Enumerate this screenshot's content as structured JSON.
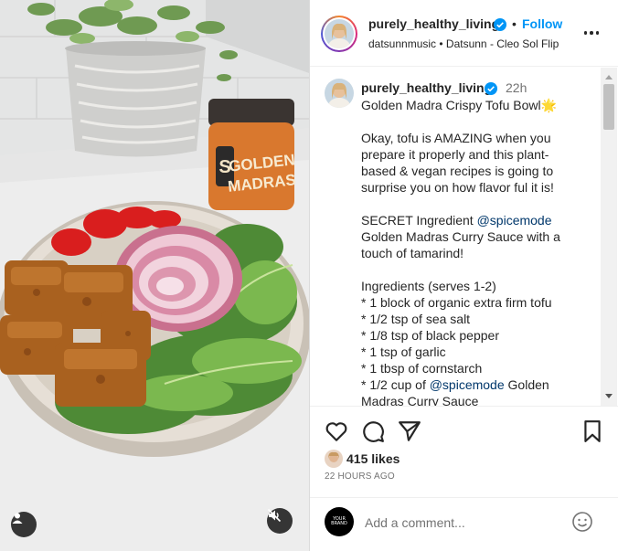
{
  "post": {
    "username": "purely_healthy_living",
    "follow_label": "Follow",
    "separator": "•",
    "audio": "datsunnmusic • Datsunn - Cleo Sol Flip",
    "more_icon": "more-horizontal-icon",
    "verified_icon": "verified-badge-icon"
  },
  "caption": {
    "username": "purely_healthy_living",
    "time": "22h",
    "lines": [
      "Golden Madra Crispy Tofu Bowl🌟",
      "",
      "Okay, tofu is AMAZING when you",
      "prepare it properly and this plant-",
      "based & vegan recipes is going to",
      "surprise you on how flavor ful it is!",
      "",
      "SECRET Ingredient",
      "Golden Madras Curry Sauce with a",
      "touch of tamarind!",
      "",
      "Ingredients (serves 1-2)",
      "* 1 block of organic extra firm tofu",
      "* 1/2 tsp of sea salt",
      "* 1/8 tsp of black pepper",
      "* 1 tsp of garlic",
      "* 1 tbsp of cornstarch",
      "* 1/2 cup of",
      "Madras Curry Sauce"
    ],
    "mention": "@spicemode",
    "mention2": "@spicemode",
    "mention2_tail": "Golden"
  },
  "actions": {
    "like_icon": "heart-icon",
    "comment_icon": "comment-icon",
    "share_icon": "send-icon",
    "save_icon": "bookmark-icon",
    "likes": "415 likes",
    "timestamp": "22 HOURS AGO"
  },
  "comment": {
    "placeholder": "Add a comment...",
    "avatar_text": "YOUR BRAND",
    "emoji_icon": "emoji-smile-icon"
  },
  "photo": {
    "jar_line1": "GOLDEN",
    "jar_line2": "MADRAS",
    "jar_logo": "S",
    "tag_icon": "user-tag-icon",
    "mute_icon": "muted-speaker-icon"
  },
  "colors": {
    "accent": "#0095f6",
    "mention": "#00376b",
    "text": "#262626",
    "muted": "#737373"
  }
}
